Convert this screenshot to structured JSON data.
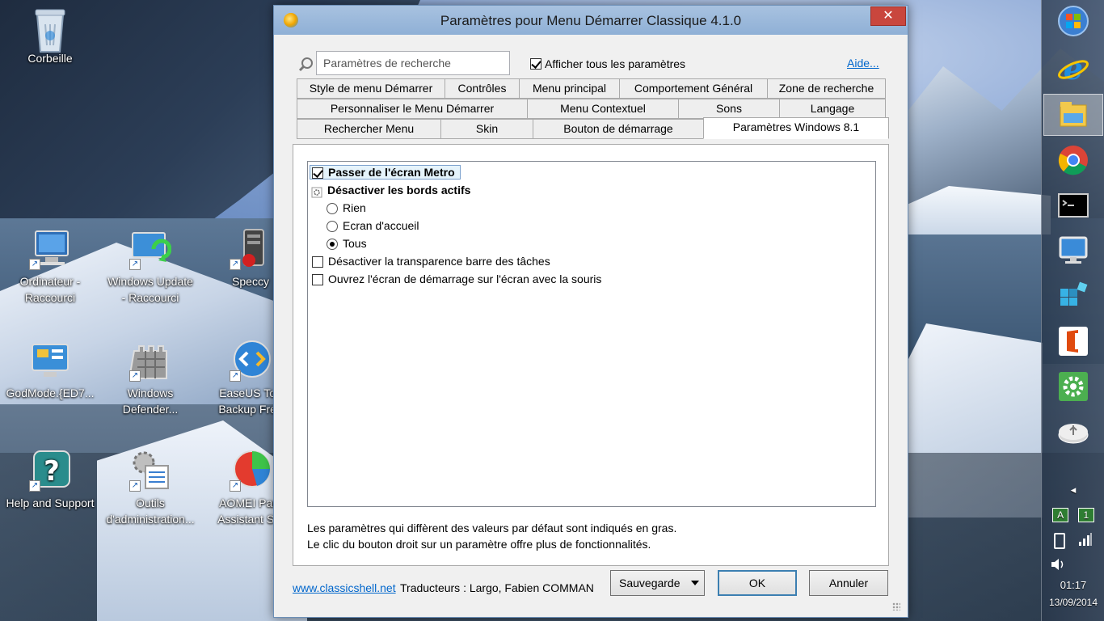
{
  "desktop": {
    "icons": [
      {
        "name": "recycle-bin",
        "label1": "Corbeille",
        "label2": ""
      },
      {
        "name": "computer",
        "label1": "Ordinateur -",
        "label2": "Raccourci"
      },
      {
        "name": "windows-update",
        "label1": "Windows Update",
        "label2": "- Raccourci"
      },
      {
        "name": "speccy",
        "label1": "Speccy",
        "label2": ""
      },
      {
        "name": "godmode",
        "label1": "GodMode.{ED7...",
        "label2": ""
      },
      {
        "name": "windows-defender",
        "label1": "Windows",
        "label2": "Defender..."
      },
      {
        "name": "easeus",
        "label1": "EaseUS Tod",
        "label2": "Backup Free"
      },
      {
        "name": "help-support",
        "label1": "Help and Support",
        "label2": ""
      },
      {
        "name": "admin-tools",
        "label1": "Outils",
        "label2": "d'administration..."
      },
      {
        "name": "aomei",
        "label1": "AOMEI Parti",
        "label2": "Assistant Sta"
      }
    ]
  },
  "window": {
    "title": "Paramètres pour Menu Démarrer Classique 4.1.0",
    "close_glyph": "✕",
    "search_placeholder": "Paramètres de recherche",
    "show_all_label": "Afficher tous les paramètres",
    "show_all_checked": true,
    "help_label": "Aide...",
    "tabs_row1": [
      "Style de menu Démarrer",
      "Contrôles",
      "Menu principal",
      "Comportement Général",
      "Zone de recherche"
    ],
    "tabs_row2": [
      "Personnaliser le Menu Démarrer",
      "Menu Contextuel",
      "Sons",
      "Langage"
    ],
    "tabs_row3": [
      "Rechercher Menu",
      "Skin",
      "Bouton de démarrage",
      "Paramètres Windows 8.1"
    ],
    "active_tab": "Paramètres Windows 8.1",
    "settings": {
      "skip_metro": "Passer de l'écran Metro",
      "disable_hot_corners": "Désactiver les bords actifs",
      "opt_none": "Rien",
      "opt_start_screen": "Ecran d'accueil",
      "opt_all": "Tous",
      "disable_taskbar_transparency": "Désactiver la transparence barre des tâches",
      "open_start_screen_mouse": "Ouvrez l'écran de démarrage sur l'écran avec la souris"
    },
    "note_line1": "Les paramètres qui diffèrent des valeurs par défaut sont indiqués en gras.",
    "note_line2": "Le clic du bouton droit sur un paramètre offre plus de fonctionnalités.",
    "site_link": "www.classicshell.net",
    "translators": "Traducteurs : Largo, Fabien COMMAN",
    "backup_label": "Sauvegarde",
    "ok_label": "OK",
    "cancel_label": "Annuler"
  },
  "taskbar": {
    "apps": [
      "windows-start-orb",
      "internet-explorer",
      "file-explorer",
      "chrome",
      "command-prompt",
      "computer-monitor",
      "registry-cubes",
      "office-app",
      "settings-gear",
      "usb-device"
    ],
    "time": "01:17",
    "date": "13/09/2014",
    "indicator_a": "A",
    "indicator_1": "1",
    "show_hidden_glyph": "◂"
  },
  "colors": {
    "window_border": "#6c8fb7",
    "titlebar": "#a8c2e0",
    "close": "#c9463d",
    "link": "#0066cc",
    "selection": "#e5f3fb"
  }
}
